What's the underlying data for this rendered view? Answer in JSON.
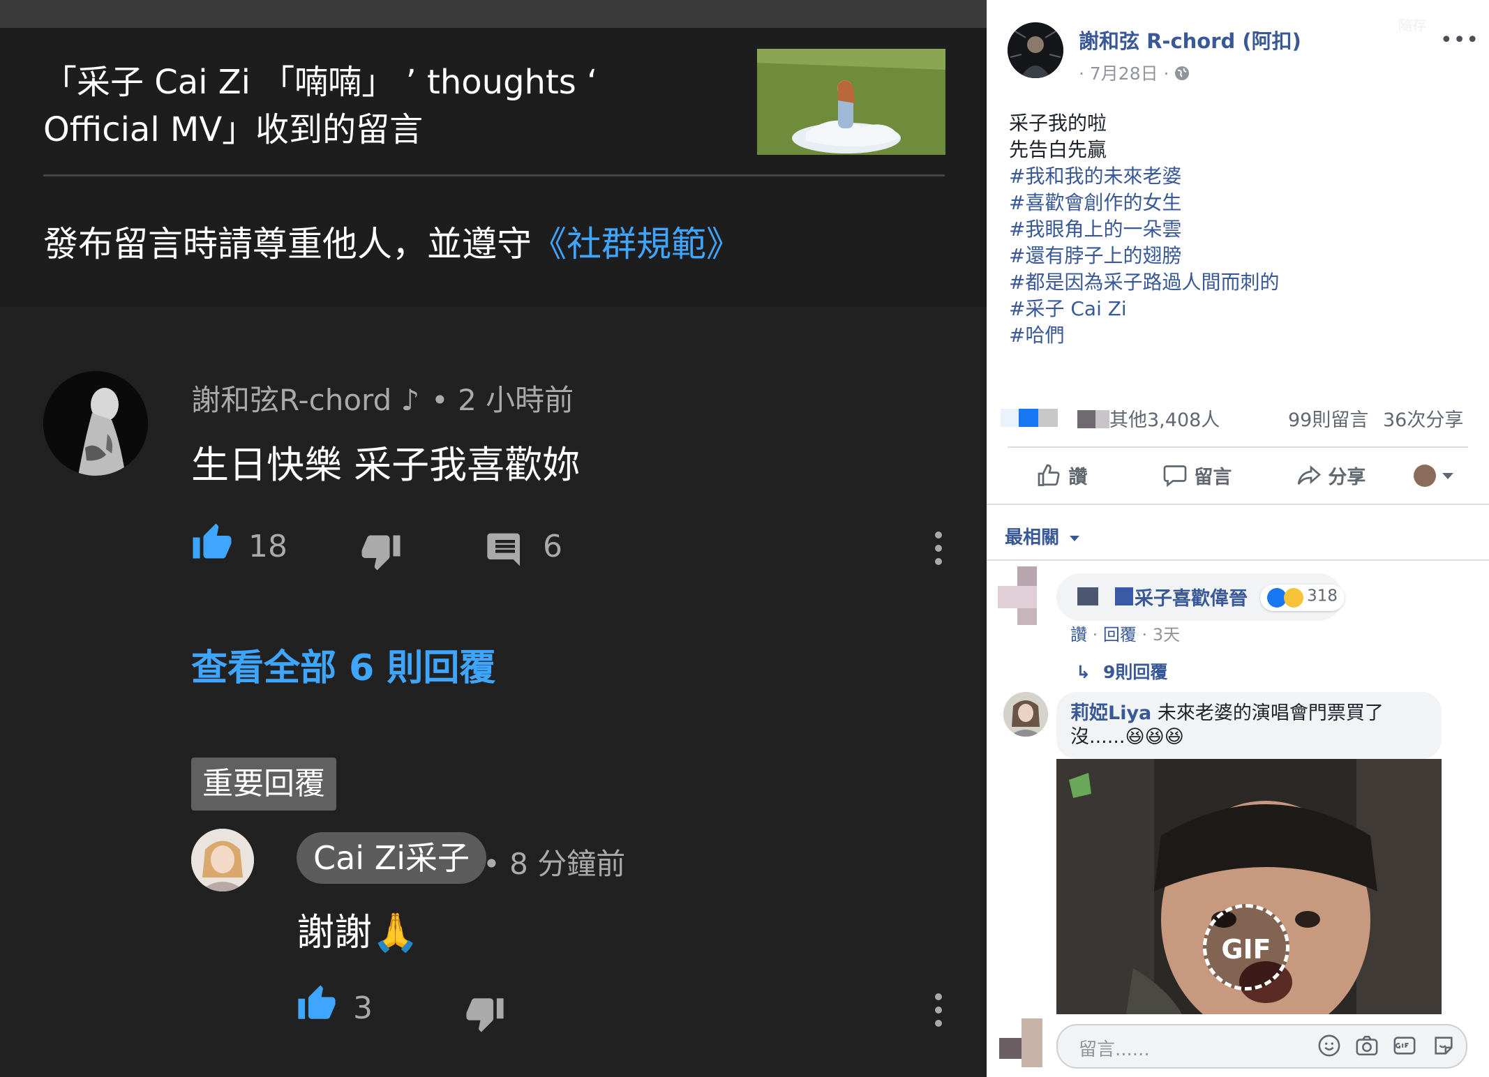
{
  "youtube": {
    "video_title": "「采子 Cai Zi 「喃喃」 ’ thoughts ‘ Official MV」收到的留言",
    "notice_prefix": "發布留言時請尊重他人，並遵守",
    "notice_link": "《社群規範》",
    "comment": {
      "author": "謝和弦R-chord",
      "time": "• 2 小時前",
      "text": "生日快樂 采子我喜歡妳",
      "likes": "18",
      "replies": "6"
    },
    "view_all_replies": "查看全部 6 則回覆",
    "pinned_label": "重要回覆",
    "reply": {
      "author": "Cai Zi采子",
      "time": "• 8 分鐘前",
      "text": "謝謝🙏",
      "likes": "3"
    },
    "colors": {
      "background": "#212121",
      "link": "#3ea6ff"
    }
  },
  "facebook": {
    "page_name": "謝和弦 R-chord (阿扣)",
    "date": "· 7月28日 ·",
    "faint_text": "隨存",
    "post_lines": [
      "采子我的啦",
      "先告白先贏"
    ],
    "hashtags": [
      "#我和我的未來老婆",
      "#喜歡會創作的女生",
      "#我眼角上的一朵雲",
      "#還有脖子上的翅膀",
      "#都是因為采子路過人間而刺的",
      "#采子 Cai Zi",
      "#哈們"
    ],
    "reactions": "其他3,408人",
    "comment_count": "99則留言",
    "share_count": "36次分享",
    "actions": {
      "like": "讚",
      "comment": "留言",
      "share": "分享"
    },
    "sort": "最相關",
    "comments": [
      {
        "name": "采子喜歡偉晉",
        "reactions": "318",
        "like": "讚",
        "reply": "回覆",
        "time": "3天",
        "replies_link": "9則回覆"
      },
      {
        "name": "莉婭Liya",
        "text_line1": "未來老婆的演唱會門票買了",
        "text_line2": "沒......😆😆😆"
      }
    ],
    "gif_label": "GIF",
    "composer_placeholder": "留言......",
    "colors": {
      "link": "#385898",
      "text": "#1d2129",
      "secondary": "#90949c"
    }
  }
}
